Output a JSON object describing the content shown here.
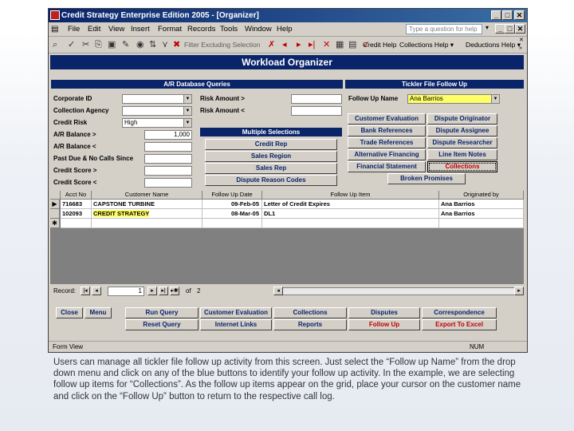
{
  "window": {
    "title": "Credit Strategy Enterprise Edition 2005 - [Organizer]",
    "controls": {
      "min": "_",
      "max": "□",
      "close": "✕"
    }
  },
  "menu": [
    "File",
    "Edit",
    "View",
    "Insert",
    "Format",
    "Records",
    "Tools",
    "Window",
    "Help"
  ],
  "ask_placeholder": "Type a question for help",
  "toolbar": {
    "filter_excluding": "Filter Excluding Selection",
    "credit_help": "Credit Help",
    "collections_help": "Collections Help ▾",
    "deductions_help": "Deductions Help ▾"
  },
  "form": {
    "title": "Workload Organizer",
    "ar_queries": {
      "header": "A/R Database Queries",
      "corporate_id": "Corporate ID",
      "collection_agency": "Collection Agency",
      "credit_risk": "Credit Risk",
      "credit_risk_value": "High",
      "ar_balance_gt": "A/R Balance >",
      "ar_balance_gt_value": "1,000",
      "ar_balance_lt": "A/R Balance <",
      "past_due": "Past Due & No Calls Since",
      "credit_score_gt": "Credit Score >",
      "credit_score_lt": "Credit Score <",
      "risk_amount_gt": "Risk Amount >",
      "risk_amount_lt": "Risk Amount <"
    },
    "multiple_selections": {
      "header": "Multiple Selections",
      "buttons": [
        "Credit Rep",
        "Sales Region",
        "Sales Rep",
        "Dispute Reason Codes"
      ]
    },
    "tickler": {
      "header": "Tickler File Follow Up",
      "follow_up_name_label": "Follow Up Name",
      "follow_up_name_value": "Ana Barrios",
      "buttons": [
        "Customer Evaluation",
        "Dispute Originator",
        "Bank References",
        "Dispute Assignee",
        "Trade References",
        "Dispute Researcher",
        "Alternative Financing",
        "Line Item Notes",
        "Financial Statement",
        "Collections",
        "Broken Promises"
      ]
    },
    "grid": {
      "columns": [
        "Acct No",
        "Customer Name",
        "Follow Up Date",
        "Follow Up Item",
        "Originated by"
      ],
      "rows": [
        [
          "716683",
          "CAPSTONE TURBINE",
          "09-Feb-05",
          "Letter of Credit Expires",
          "Ana Barrios"
        ],
        [
          "102093",
          "CREDIT STRATEGY",
          "08-Mar-05",
          "DL1",
          "Ana Barrios"
        ]
      ],
      "current_marker": "▶",
      "new_marker": "✱"
    },
    "record_nav": {
      "label": "Record:",
      "current": "1",
      "of": "of",
      "total": "2"
    },
    "bottom_buttons": {
      "close": "Close",
      "menu": "Menu",
      "run_query": "Run Query",
      "reset_query": "Reset Query",
      "customer_evaluation": "Customer Evaluation",
      "internet_links": "Internet Links",
      "collections": "Collections",
      "reports": "Reports",
      "disputes": "Disputes",
      "follow_up": "Follow Up",
      "correspondence": "Correspondence",
      "export_to_excel": "Export To Excel"
    }
  },
  "status": {
    "left": "Form View",
    "right": "NUM"
  },
  "caption": "Users can manage all tickler file follow up activity from this screen. Just select the “Follow up Name” from the drop down menu and click on any of the blue buttons to identify your follow up activity. In the example, we are selecting follow up items for “Collections”. As the follow up items appear on the grid, place your cursor on the customer name and click on the “Follow Up” button to return to the respective call log.",
  "colors": {
    "accent": "#0a246a",
    "highlight": "#ffff66",
    "alert": "#c00000"
  }
}
